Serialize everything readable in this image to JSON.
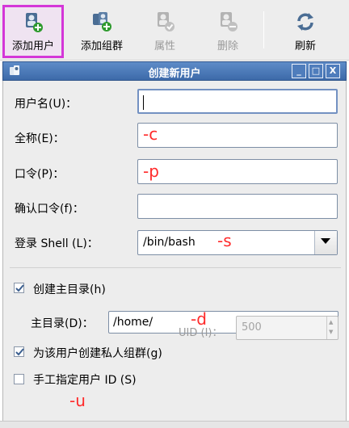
{
  "toolbar": {
    "add_user": "添加用户",
    "add_group": "添加组群",
    "properties": "属性",
    "delete": "删除",
    "refresh": "刷新"
  },
  "dialog": {
    "title": "创建新用户",
    "window_buttons": {
      "minimize": "_",
      "maximize": "□",
      "close": "X"
    }
  },
  "form": {
    "username_label": "用户名(U)：",
    "username_value": "",
    "fullname_label": "全称(E)：",
    "password_label": "口令(P)：",
    "confirm_label": "确认口令(f)：",
    "shell_label": "登录 Shell (L)：",
    "shell_value": "/bin/bash",
    "create_home_label": "创建主目录(h)",
    "create_home_checked": true,
    "homedir_label": "主目录(D)：",
    "homedir_value": "/home/",
    "private_group_label": "为该用户创建私人组群(g)",
    "private_group_checked": true,
    "manual_uid_label": "手工指定用户 ID (S)",
    "manual_uid_checked": false,
    "uid_label": "UID (I)：",
    "uid_value": "500"
  },
  "annotations": {
    "fullname": "-c",
    "password": "-p",
    "shell": "-s",
    "homedir": "-d",
    "uid": "-u"
  },
  "colors": {
    "highlight_border": "#d437d8",
    "titlebar": "#3d6aa9",
    "annotation": "#ff2a2a"
  }
}
